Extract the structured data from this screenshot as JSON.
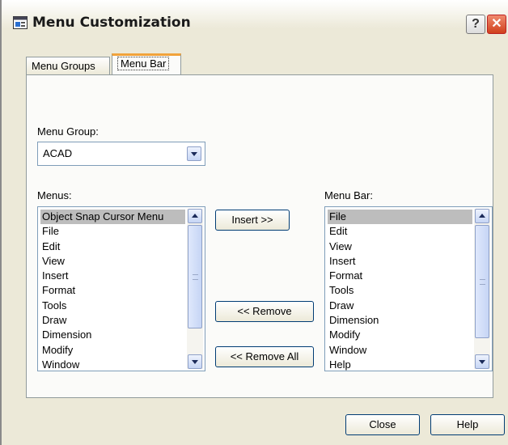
{
  "window": {
    "title": "Menu Customization",
    "help_glyph": "?",
    "close_glyph": "✕"
  },
  "tabs": [
    {
      "label": "Menu Groups",
      "selected": false
    },
    {
      "label": "Menu Bar",
      "selected": true
    }
  ],
  "menu_group": {
    "label": "Menu Group:",
    "value": "ACAD"
  },
  "menus": {
    "label": "Menus:",
    "items": [
      "Object Snap Cursor Menu",
      "File",
      "Edit",
      "View",
      "Insert",
      "Format",
      "Tools",
      "Draw",
      "Dimension",
      "Modify",
      "Window"
    ]
  },
  "menu_bar": {
    "label": "Menu Bar:",
    "items": [
      "File",
      "Edit",
      "View",
      "Insert",
      "Format",
      "Tools",
      "Draw",
      "Dimension",
      "Modify",
      "Window",
      "Help"
    ]
  },
  "buttons": {
    "insert": "Insert >>",
    "remove": "<< Remove",
    "remove_all": "<< Remove All",
    "close": "Close",
    "help": "Help"
  },
  "colors": {
    "dialog_bg": "#ece9d8",
    "tab_accent": "#f1a23a",
    "selection": "#bdbdbd",
    "close_red": "#d0401c"
  }
}
